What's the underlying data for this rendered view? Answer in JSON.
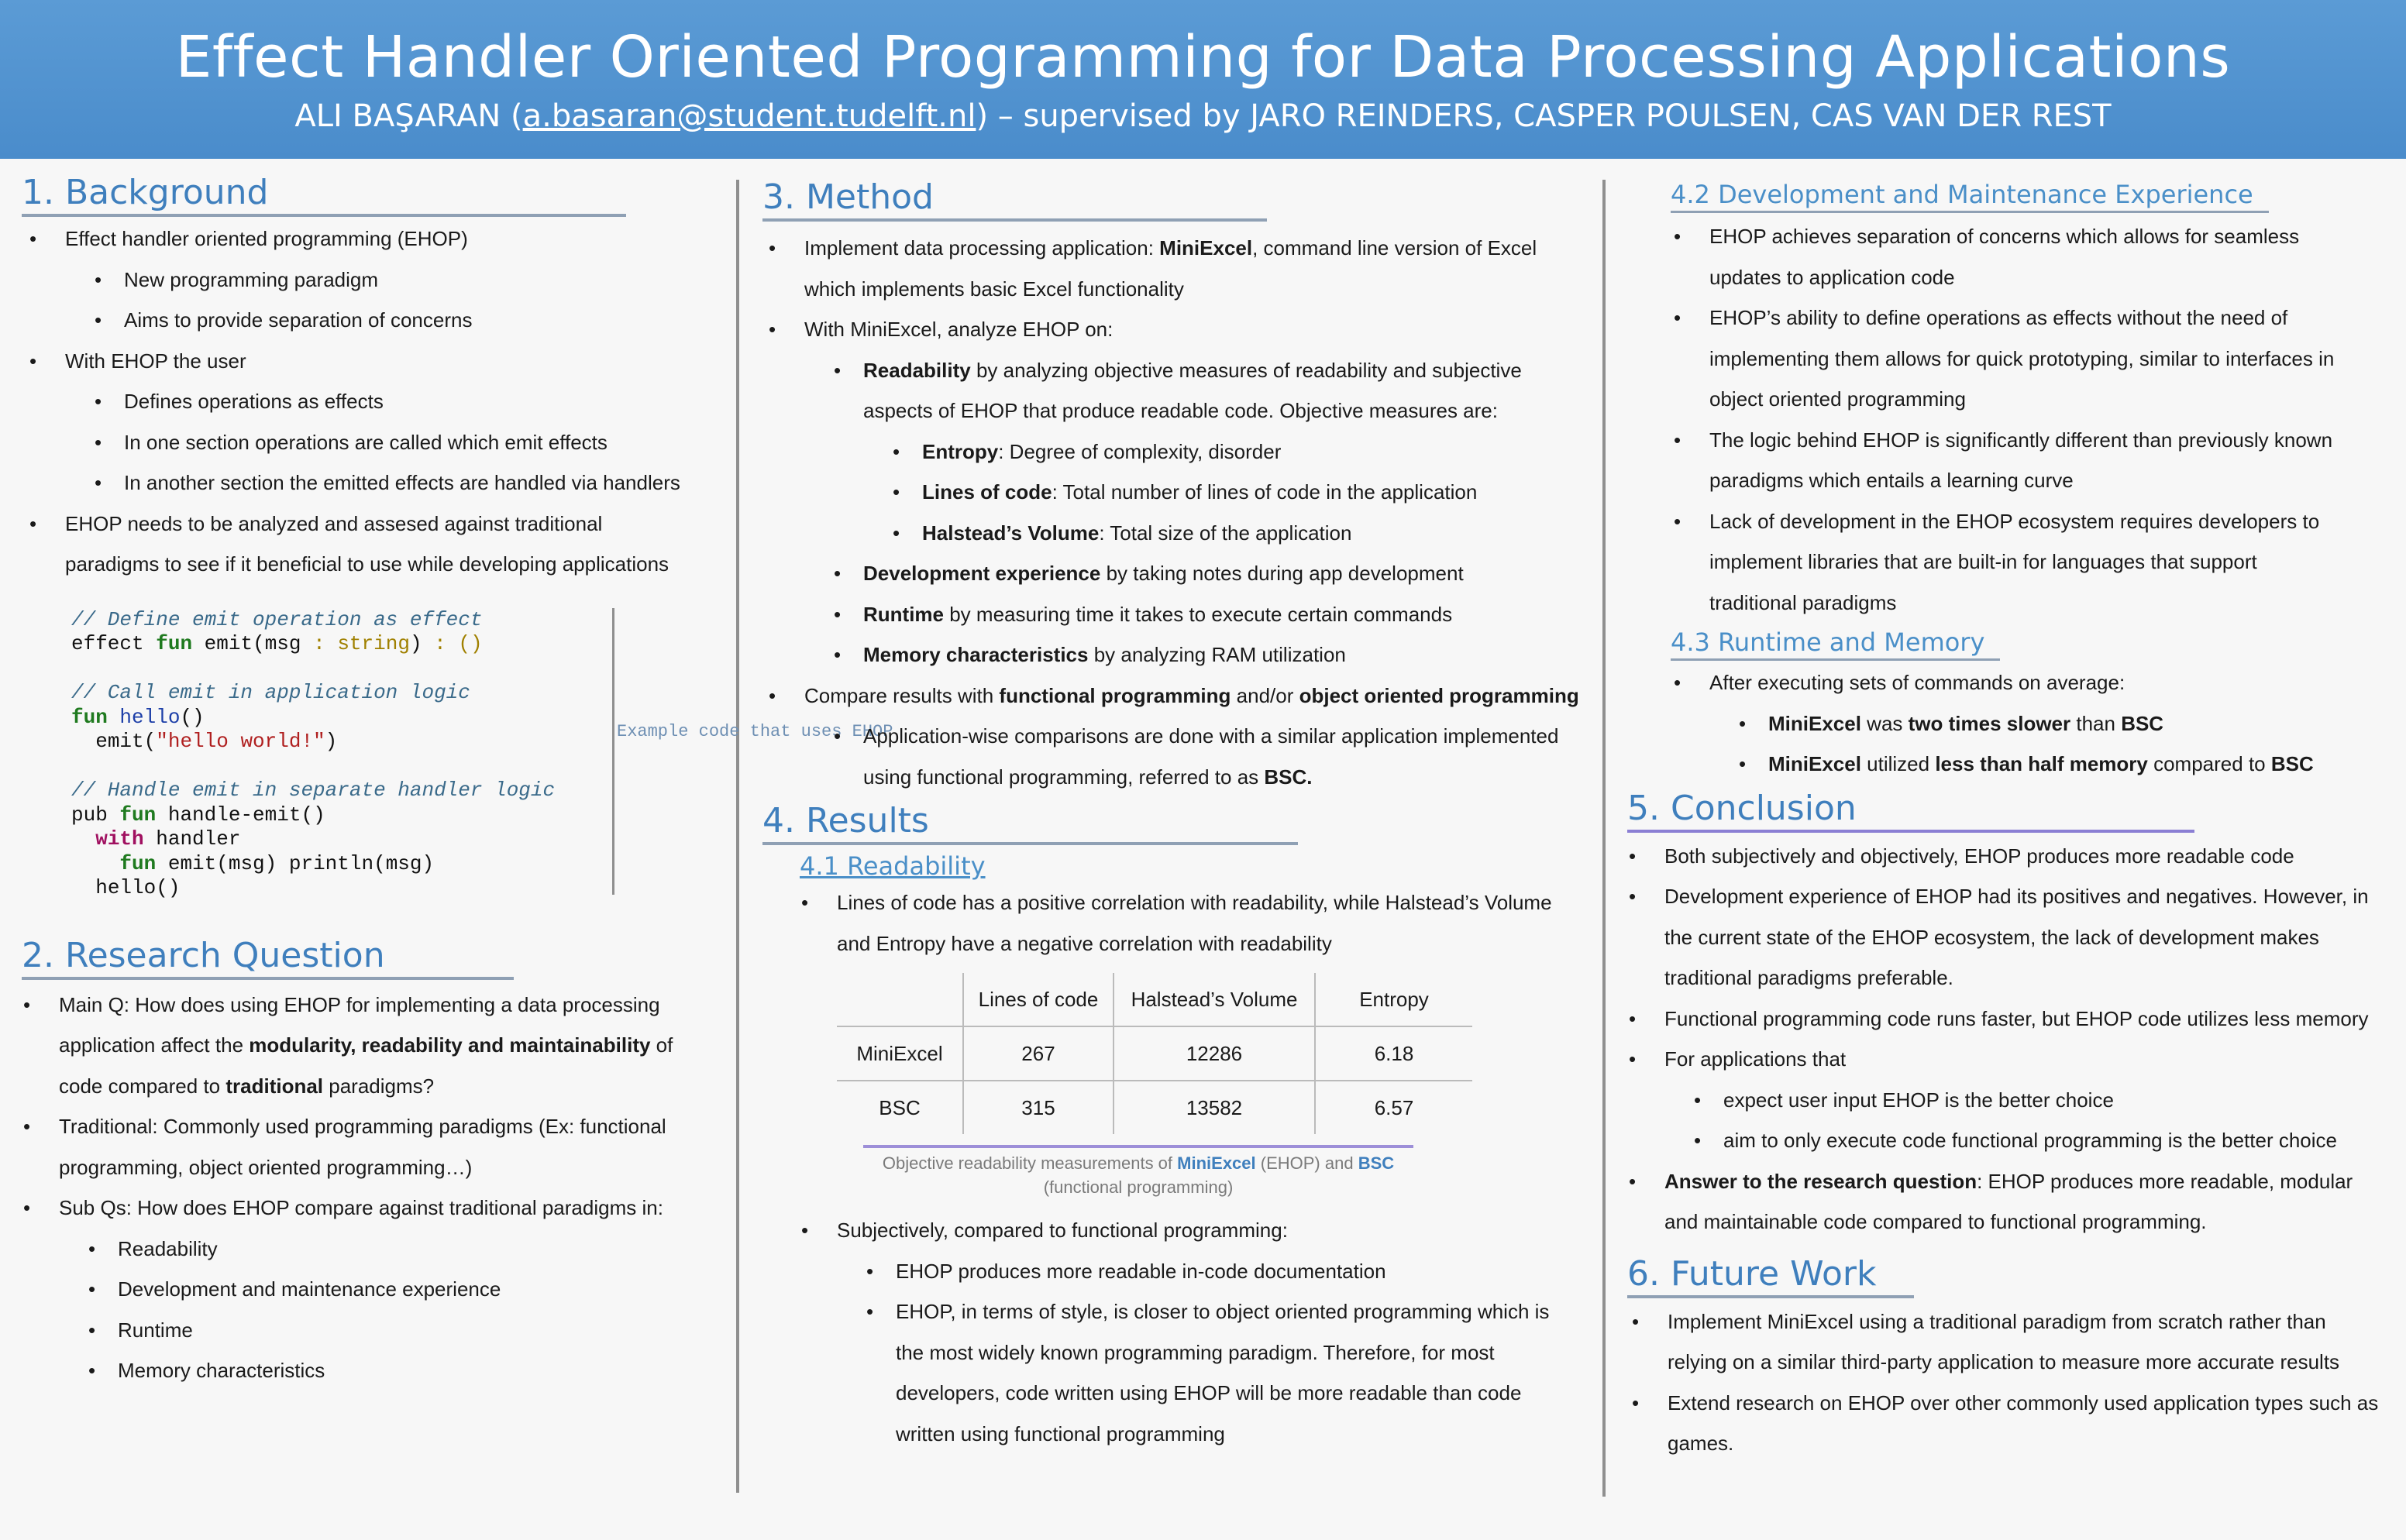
{
  "header": {
    "title": "Effect Handler Oriented Programming for Data Processing Applications",
    "author": "ALI BAŞARAN",
    "email": "a.basaran@student.tudelft.nl",
    "supervisors": "– supervised by JARO REINDERS, CASPER POULSEN, CAS VAN DER REST"
  },
  "background": {
    "heading": "1. Background",
    "ehop": "Effect handler oriented programming (EHOP)",
    "ehop_sub": [
      "New programming paradigm",
      "Aims to provide separation of concerns"
    ],
    "user": "With EHOP the user",
    "user_sub": [
      "Defines operations as effects",
      "In one section operations are called which emit effects",
      "In another section the emitted effects are handled via handlers"
    ],
    "analyze": "EHOP needs to be analyzed and assesed against traditional paradigms to see if it beneficial to use while developing applications",
    "code_caption": "Example code that uses EHOP"
  },
  "code": {
    "c1": "// Define emit operation as effect",
    "l1": [
      "effect",
      "fun",
      "emit",
      "msg",
      "string",
      "()"
    ],
    "c2": "// Call emit in application logic",
    "l2": [
      "fun",
      "hello",
      "()"
    ],
    "l3": [
      "emit(",
      "\"hello world!\"",
      ")"
    ],
    "c3": "// Handle emit in separate handler logic",
    "l4": [
      "pub",
      "fun",
      "handle-emit()"
    ],
    "l5": [
      "with",
      "handler"
    ],
    "l6": [
      "fun",
      "emit(msg) println(msg)"
    ],
    "l7": "hello()"
  },
  "research": {
    "heading": "2. Research Question",
    "main_pre": "Main Q: How does using EHOP for implementing a data processing application affect the ",
    "main_bold": "modularity, readability and maintainability",
    "main_mid": " of code compared to ",
    "main_bold2": "traditional",
    "main_post": " paradigms?",
    "traditional": "Traditional: Commonly used programming paradigms (Ex: functional programming, object oriented programming…)",
    "sub": "Sub Qs: How does EHOP compare against traditional paradigms in:",
    "sub_items": [
      "Readability",
      "Development and maintenance experience",
      "Runtime",
      "Memory characteristics"
    ]
  },
  "method": {
    "heading": "3. Method",
    "impl_pre": "Implement data processing application: ",
    "impl_bold": "MiniExcel",
    "impl_post": ", command line version of Excel which implements basic Excel functionality",
    "analyze": "With MiniExcel, analyze EHOP on:",
    "readability_bold": "Readability",
    "readability_text": " by analyzing objective measures of readability and subjective aspects of EHOP that produce readable code. Objective measures are:",
    "measures": [
      {
        "name": "Entropy",
        "desc": ": Degree of complexity, disorder"
      },
      {
        "name": "Lines of code",
        "desc": ": Total number of lines of code in the application"
      },
      {
        "name": "Halstead’s Volume",
        "desc": ": Total size of the application"
      }
    ],
    "others": [
      {
        "name": "Development experience",
        "desc": " by taking notes during app development"
      },
      {
        "name": "Runtime",
        "desc": " by measuring time it takes to execute certain commands"
      },
      {
        "name": "Memory characteristics",
        "desc": " by analyzing RAM utilization"
      }
    ],
    "compare_pre": "Compare results with ",
    "compare_b1": "functional programming",
    "compare_mid": " and/or ",
    "compare_b2": "object oriented programming",
    "app_pre": "Application-wise comparisons are done with a similar application implemented using functional programming, referred to as ",
    "app_bold": "BSC."
  },
  "results": {
    "heading": "4. Results",
    "sub_heading": "4.1 Readability",
    "loc": "Lines of code has a positive correlation with readability, while Halstead’s Volume and Entropy have a negative correlation with readability",
    "table": {
      "headers": [
        "",
        "Lines of code",
        "Halstead’s Volume",
        "Entropy"
      ],
      "rows": [
        [
          "MiniExcel",
          "267",
          "12286",
          "6.18"
        ],
        [
          "BSC",
          "315",
          "13582",
          "6.57"
        ]
      ]
    },
    "caption_pre": "Objective readability measurements of ",
    "caption_b1": "MiniExcel",
    "caption_mid": " (EHOP) and ",
    "caption_b2": "BSC",
    "caption_post": " (functional programming)",
    "subjective": "Subjectively, compared to functional programming:",
    "subjective_items": [
      "EHOP produces more readable in-code documentation",
      "EHOP, in terms of style, is closer to object oriented programming which is the most widely known programming paradigm. Therefore, for most developers, code written using EHOP will be more readable than code written using functional programming"
    ]
  },
  "dev": {
    "heading": "4.2 Development and Maintenance Experience",
    "items": [
      "EHOP achieves separation of concerns which allows for seamless updates to application code",
      "EHOP’s ability to define operations as effects without the need of implementing them allows for quick prototyping, similar to interfaces in object oriented programming",
      "The logic behind EHOP is significantly different than previously known paradigms which entails a learning curve",
      "Lack of development in the EHOP ecosystem requires developers to implement libraries that are built-in for languages that support traditional paradigms"
    ]
  },
  "runtime": {
    "heading": "4.3 Runtime and Memory",
    "intro": "After executing sets of commands on average:",
    "slow": [
      "MiniExcel",
      " was ",
      "two times slower",
      " than ",
      "BSC"
    ],
    "mem": [
      "MiniExcel",
      " utilized ",
      "less than half memory",
      " compared to ",
      "BSC"
    ]
  },
  "conclusion": {
    "heading": "5. Conclusion",
    "items": [
      "Both subjectively and objectively, EHOP produces more readable code",
      "Development experience of EHOP had its positives and negatives. However, in the current state of the EHOP ecosystem, the lack of development makes traditional paradigms preferable.",
      "Functional programming code runs faster, but EHOP code utilizes less memory"
    ],
    "for_apps": "For applications that",
    "for_apps_sub": [
      "expect user input EHOP is the better choice",
      "aim to only execute code functional programming is the better choice"
    ],
    "answer_bold": "Answer to the research question",
    "answer_text": ": EHOP produces more readable, modular and maintainable code compared to functional programming."
  },
  "future": {
    "heading": "6. Future Work",
    "items": [
      "Implement MiniExcel using a traditional paradigm from scratch rather than relying on a similar third-party application to measure more accurate results",
      "Extend research on EHOP over other commonly used application types such as games."
    ]
  }
}
